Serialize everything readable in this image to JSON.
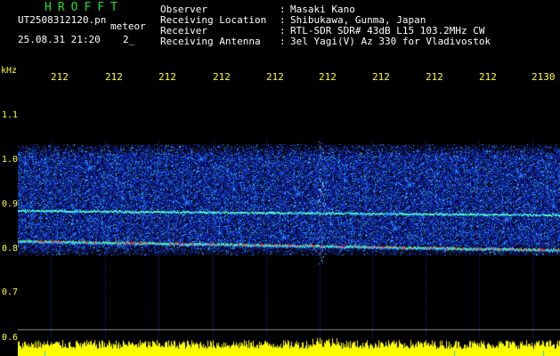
{
  "header": {
    "title": "HROFFT",
    "file_name": "UT2508312120.pn",
    "meteor_label": "meteor",
    "date_time": "25.08.31 21:20",
    "count": "2_"
  },
  "info": [
    {
      "label": "Observer",
      "sep": ":",
      "value": "Masaki Kano"
    },
    {
      "label": "Receiving Location",
      "sep": ":",
      "value": "Shibukawa, Gunma, Japan"
    },
    {
      "label": "Receiver",
      "sep": ":",
      "value": "RTL-SDR SDR# 43dB L15 103.2MHz CW"
    },
    {
      "label": "Receiving Antenna",
      "sep": ":",
      "value": "3el Yagi(V) Az 330 for Vladivostok"
    }
  ],
  "axis": {
    "unit": "kHz",
    "x_ticks": [
      "212",
      "212",
      "212",
      "212",
      "212",
      "212",
      "212",
      "212",
      "212",
      "2130"
    ],
    "y_ticks": [
      "1.1",
      "1.0",
      "0.9",
      "0.8",
      "0.7",
      "0.6"
    ]
  },
  "colors": {
    "background": "#000000",
    "axis_text": "#ffff33",
    "header_title": "#22e022",
    "text": "#ffffff"
  }
}
